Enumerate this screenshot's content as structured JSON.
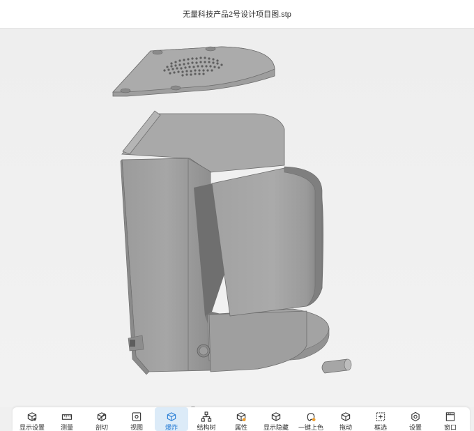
{
  "window": {
    "title": "无量科技产品2号设计项目图.stp"
  },
  "toolbar": {
    "items": [
      {
        "label": "显示设置",
        "icon": "display-settings-icon"
      },
      {
        "label": "测量",
        "icon": "measure-icon"
      },
      {
        "label": "剖切",
        "icon": "section-cut-icon"
      },
      {
        "label": "视图",
        "icon": "view-icon"
      },
      {
        "label": "爆炸",
        "icon": "explode-icon",
        "active": true
      },
      {
        "label": "结构树",
        "icon": "structure-tree-icon"
      },
      {
        "label": "属性",
        "icon": "properties-icon"
      },
      {
        "label": "显示隐藏",
        "icon": "show-hide-icon"
      },
      {
        "label": "一键上色",
        "icon": "one-click-color-icon"
      },
      {
        "label": "拖动",
        "icon": "drag-icon"
      },
      {
        "label": "框选",
        "icon": "box-select-icon"
      },
      {
        "label": "设置",
        "icon": "settings-icon"
      },
      {
        "label": "窗口",
        "icon": "window-icon"
      }
    ]
  },
  "colors": {
    "accent": "#2b7fd6",
    "active_bg": "#dcebf8",
    "model_gray": "#9a9a9a"
  }
}
